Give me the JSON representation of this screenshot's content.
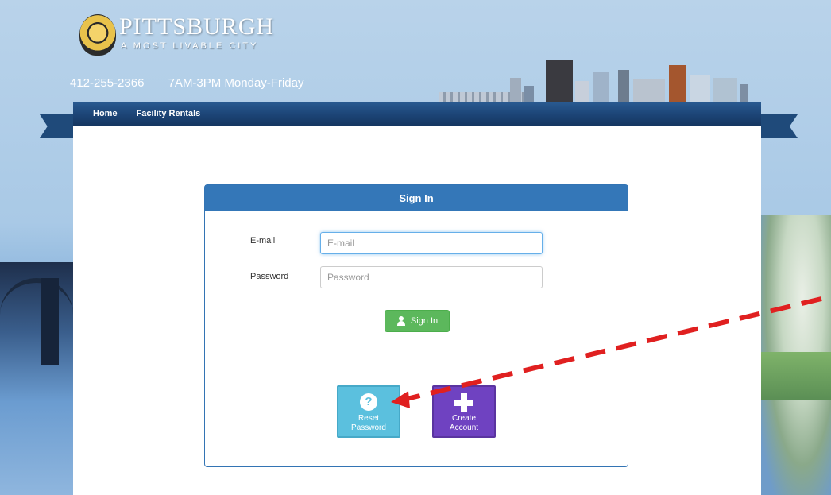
{
  "header": {
    "logo_title": "PITTSBURGH",
    "logo_tagline": "A MOST LIVABLE CITY",
    "phone": "412-255-2366",
    "hours": "7AM-3PM Monday-Friday"
  },
  "nav": {
    "items": [
      {
        "label": "Home"
      },
      {
        "label": "Facility Rentals"
      }
    ]
  },
  "signin_panel": {
    "title": "Sign In",
    "email": {
      "label": "E-mail",
      "placeholder": "E-mail",
      "value": ""
    },
    "password": {
      "label": "Password",
      "placeholder": "Password",
      "value": ""
    },
    "signin_button": {
      "label": "Sign In",
      "icon": "user-icon"
    },
    "reset_tile": {
      "line1": "Reset",
      "line2": "Password",
      "icon": "question-circle-icon"
    },
    "create_tile": {
      "line1": "Create",
      "line2": "Account",
      "icon": "plus-icon"
    }
  },
  "colors": {
    "nav": "#1c4476",
    "panel_header": "#3477b8",
    "signin_button": "#5cb85c",
    "reset_tile": "#5bc0de",
    "create_tile": "#6f42c1",
    "annotation_arrow": "#e02020"
  }
}
